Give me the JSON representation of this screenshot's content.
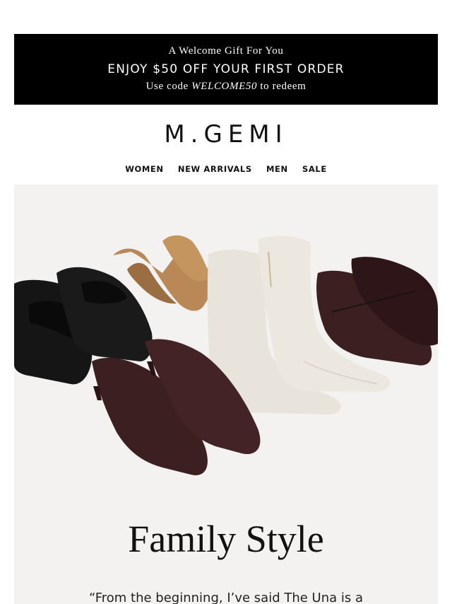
{
  "promo": {
    "line1": "A Welcome Gift For You",
    "line2": "ENJOY $50 OFF YOUR FIRST ORDER",
    "line3_prefix": "Use code ",
    "code": "WELCOME50",
    "line3_suffix": " to redeem"
  },
  "brand": {
    "logo_text": "M.GEMI"
  },
  "nav": {
    "items": [
      "WOMEN",
      "NEW ARRIVALS",
      "MEN",
      "SALE"
    ]
  },
  "hero": {
    "image_alt": "shoe lineup",
    "headline": "Family Style",
    "quote_start": "“From the beginning, I’ve said The Una is a"
  },
  "colors": {
    "banner_bg": "#000000",
    "hero_bg": "#f3f2f0",
    "black_leather": "#151515",
    "camel": "#b98856",
    "cream": "#e9e4dc",
    "burgundy": "#3b1f21"
  }
}
